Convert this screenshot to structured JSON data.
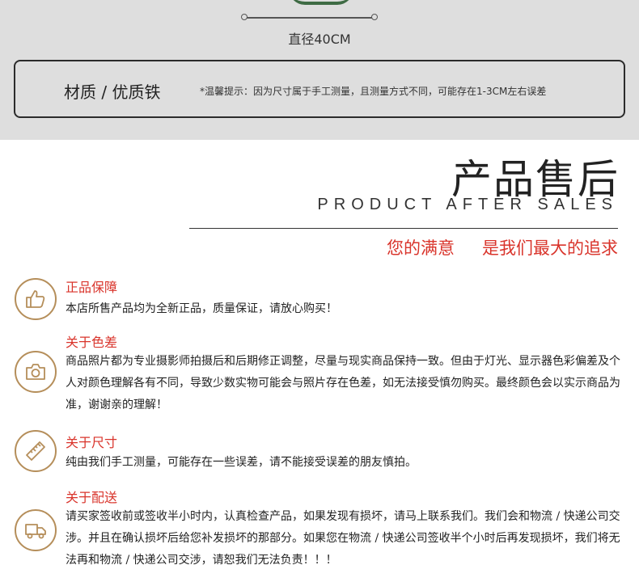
{
  "product_spec": {
    "diameter": "直径40CM",
    "material": "材质 / 优质铁",
    "note": "*温馨提示：因为尺寸属于手工测量，且测量方式不同，可能存在1-3CM左右误差"
  },
  "after_sales": {
    "title_cn": "产品售后",
    "title_en": "PRODUCT AFTER SALES",
    "slogan_1": "您的满意",
    "slogan_2": "是我们最大的追求"
  },
  "items": [
    {
      "icon": "thumbs-up-icon",
      "title": "正品保障",
      "text": "本店所售产品均为全新正品，质量保证，请放心购买！"
    },
    {
      "icon": "camera-icon",
      "title": "关于色差",
      "text": "商品照片都为专业摄影师拍摄后和后期修正调整，尽量与现实商品保持一致。但由于灯光、显示器色彩偏差及个人对颜色理解各有不同，导致少数实物可能会与照片存在色差，如无法接受慎勿购买。最终颜色会以实示商品为准，谢谢亲的理解！"
    },
    {
      "icon": "ruler-icon",
      "title": "关于尺寸",
      "text": "纯由我们手工测量，可能存在一些误差，请不能接受误差的朋友慎拍。"
    },
    {
      "icon": "truck-icon",
      "title": "关于配送",
      "text": "请买家签收前或签收半小时内，认真检查产品，如果发现有损坏，请马上联系我们。我们会和物流 / 快递公司交涉。并且在确认损坏后给您补发损坏的那部分。如果您在物流 / 快递公司签收半个小时后再发现损坏，我们将无法再和物流 / 快递公司交涉，请恕我们无法负责！！！"
    }
  ],
  "colors": {
    "accent": "#d9342b",
    "icon_ring": "#b58e5a",
    "spec_bg": "#dedede"
  }
}
